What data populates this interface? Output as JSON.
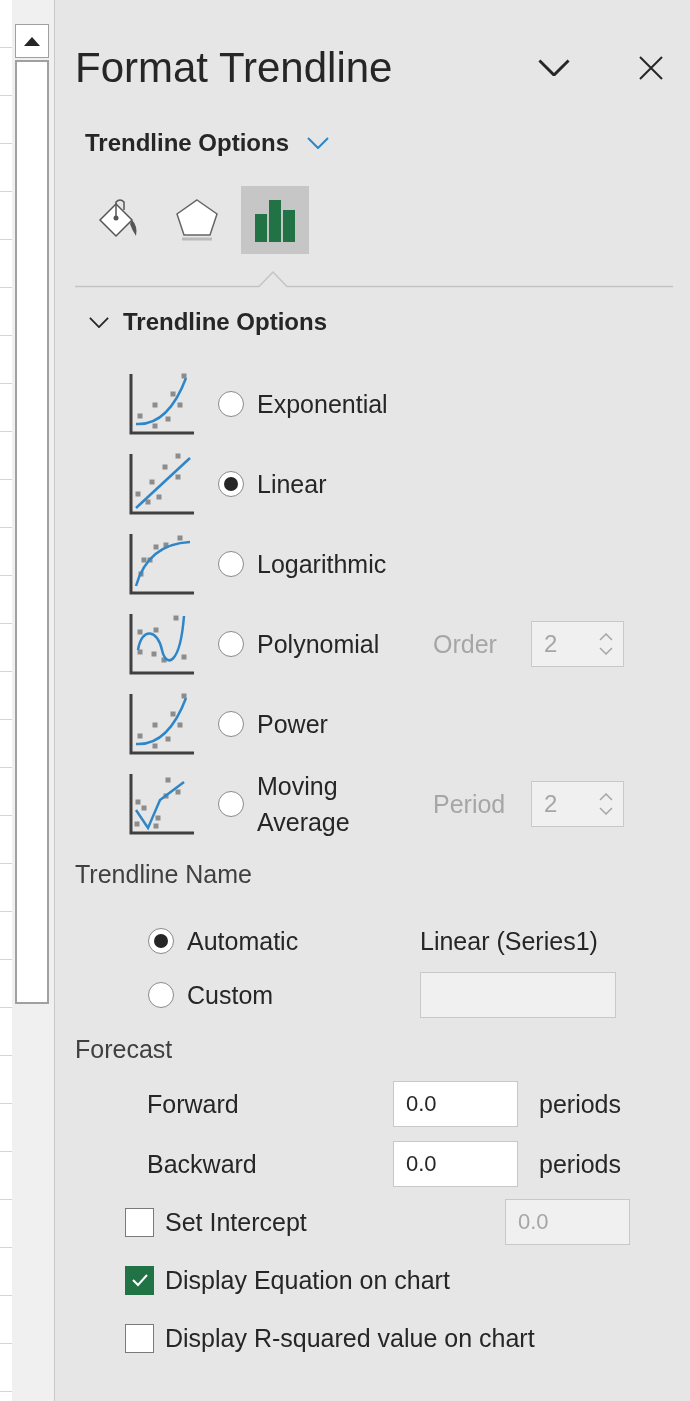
{
  "pane": {
    "title": "Format Trendline"
  },
  "category": {
    "label": "Trendline Options"
  },
  "tabs": [
    {
      "kind": "fill",
      "selected": false
    },
    {
      "kind": "effects",
      "selected": false
    },
    {
      "kind": "options",
      "selected": true
    }
  ],
  "section": {
    "title": "Trendline Options",
    "expanded": true
  },
  "trend_types": [
    {
      "kind": "exponential",
      "label": "Exponential",
      "selected": false
    },
    {
      "kind": "linear",
      "label": "Linear",
      "selected": true
    },
    {
      "kind": "logarithmic",
      "label": "Logarithmic",
      "selected": false
    },
    {
      "kind": "polynomial",
      "label": "Polynomial",
      "selected": false,
      "option": {
        "label": "Order",
        "value": "2",
        "disabled": true
      }
    },
    {
      "kind": "power",
      "label": "Power",
      "selected": false
    },
    {
      "kind": "moving_average",
      "label": "Moving Average",
      "selected": false,
      "option": {
        "label": "Period",
        "value": "2",
        "disabled": true
      }
    }
  ],
  "trendline_name": {
    "heading": "Trendline Name",
    "options": [
      {
        "kind": "automatic",
        "label": "Automatic",
        "selected": true,
        "value": "Linear (Series1)"
      },
      {
        "kind": "custom",
        "label": "Custom",
        "selected": false
      }
    ]
  },
  "forecast": {
    "heading": "Forecast",
    "rows": [
      {
        "label": "Forward",
        "value": "0.0",
        "unit": "periods"
      },
      {
        "label": "Backward",
        "value": "0.0",
        "unit": "periods"
      }
    ]
  },
  "checks": [
    {
      "label": "Set Intercept",
      "checked": false,
      "field": {
        "value": "0.0",
        "disabled": true
      }
    },
    {
      "label": "Display Equation on chart",
      "checked": true
    },
    {
      "label": "Display R-squared value on chart",
      "checked": false
    }
  ]
}
